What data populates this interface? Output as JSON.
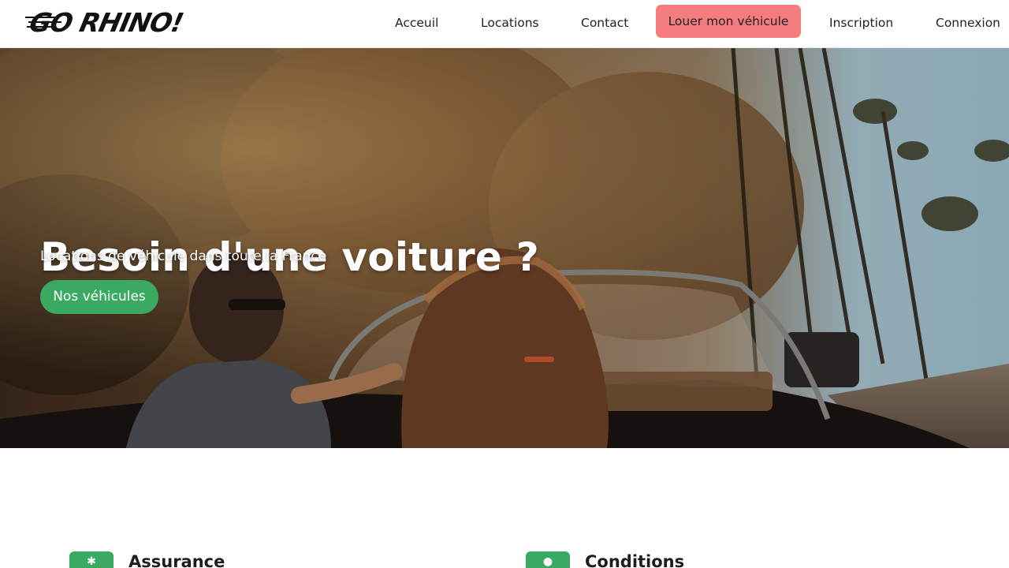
{
  "brand": {
    "logo_text": "GO RHINO!"
  },
  "nav": {
    "items": [
      {
        "label": "Acceuil"
      },
      {
        "label": "Locations"
      },
      {
        "label": "Contact"
      },
      {
        "label": "Inscription"
      },
      {
        "label": "Connexion"
      }
    ],
    "cta_label": "Louer mon véhicule",
    "cta_color": "#f47c7c"
  },
  "hero": {
    "title": "Besoin d'une voiture ?",
    "subtitle": "Locations de véhicule dans toute la France",
    "button_label": "Nos véhicules",
    "button_color": "#3aaa63",
    "image_description_icon": "convertible-car-photo"
  },
  "features": [
    {
      "title": "Assurance",
      "icon": "shield-icon"
    },
    {
      "title": "Conditions",
      "icon": "info-icon"
    }
  ],
  "colors": {
    "accent_green": "#3aaa63",
    "accent_red": "#f47c7c"
  }
}
